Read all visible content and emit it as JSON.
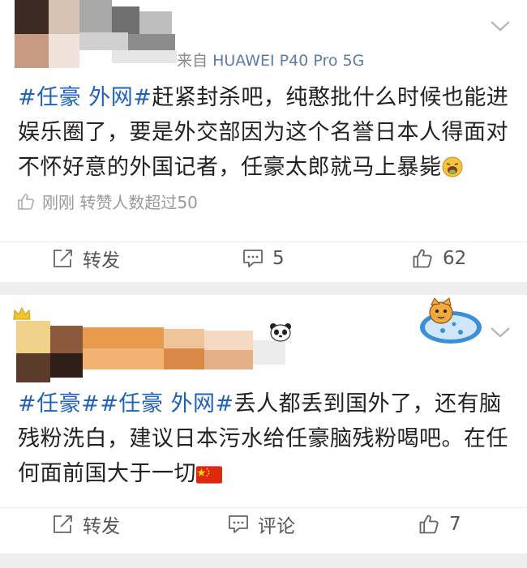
{
  "posts": [
    {
      "source_prefix": "来自",
      "device": "HUAWEI P40 Pro 5G",
      "text": {
        "tag1": "#任豪 外网#",
        "body": "赶紧封杀吧，纯憨批什么时候也能进娱乐圈了，要是外交部因为这个名誉日本人得面对不怀好意的外国记者，任豪太郎就马上暴毙"
      },
      "meta": "刚刚 转赞人数超过50",
      "actions": {
        "repost": "转发",
        "comment": "5",
        "like": "62"
      }
    },
    {
      "text": {
        "tag1": "#任豪#",
        "tag2": "#任豪 外网#",
        "body": "丢人都丢到国外了，还有脑残粉洗白，建议日本污水给任豪脑残粉喝吧。在任何面前国大于一切"
      },
      "actions": {
        "repost": "转发",
        "comment": "评论",
        "like": "7"
      }
    }
  ],
  "colors": {
    "tag": "#1f62bf",
    "device": "#5c7ca6",
    "divider": "#eeeeee"
  },
  "icons": [
    "chevron-down-icon",
    "share-icon",
    "comment-icon",
    "thumbs-up-icon",
    "panda-icon",
    "china-flag-icon",
    "vomit-emoji-icon"
  ]
}
